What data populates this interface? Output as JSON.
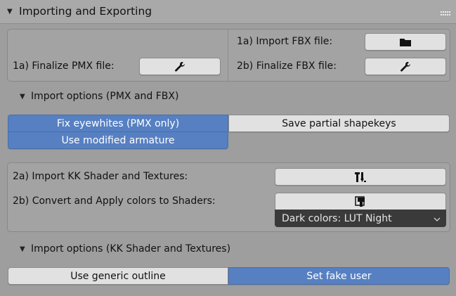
{
  "panel": {
    "title": "Importing and Exporting"
  },
  "import_export": {
    "import_fbx_label": "1a) Import FBX file:",
    "finalize_pmx_label": "1a) Finalize PMX file:",
    "finalize_fbx_label": "2b) Finalize FBX file:"
  },
  "import_options": {
    "title": "Import options (PMX and FBX)",
    "fix_eyewhites": "Fix eyewhites (PMX only)",
    "save_partial_shapekeys": "Save partial shapekeys",
    "use_modified_armature": "Use modified armature"
  },
  "shaders": {
    "import_kk_label": "2a) Import KK Shader and Textures:",
    "convert_colors_label": "2b) Convert and Apply colors to Shaders:",
    "dark_colors_value": "Dark colors: LUT Night"
  },
  "kk_options": {
    "title": "Import options (KK Shader and Textures)",
    "use_generic_outline": "Use generic outline",
    "set_fake_user": "Set fake user"
  },
  "icons": {
    "folder": "folder-icon",
    "wrench": "wrench-icon",
    "shader": "shader-import-icon",
    "paint": "paint-apply-icon",
    "collapse": "triangle-down-icon",
    "grip": "drag-grip-icon"
  },
  "colors": {
    "accent": "#5680c2",
    "dropdown_bg": "#3a3a3a"
  }
}
